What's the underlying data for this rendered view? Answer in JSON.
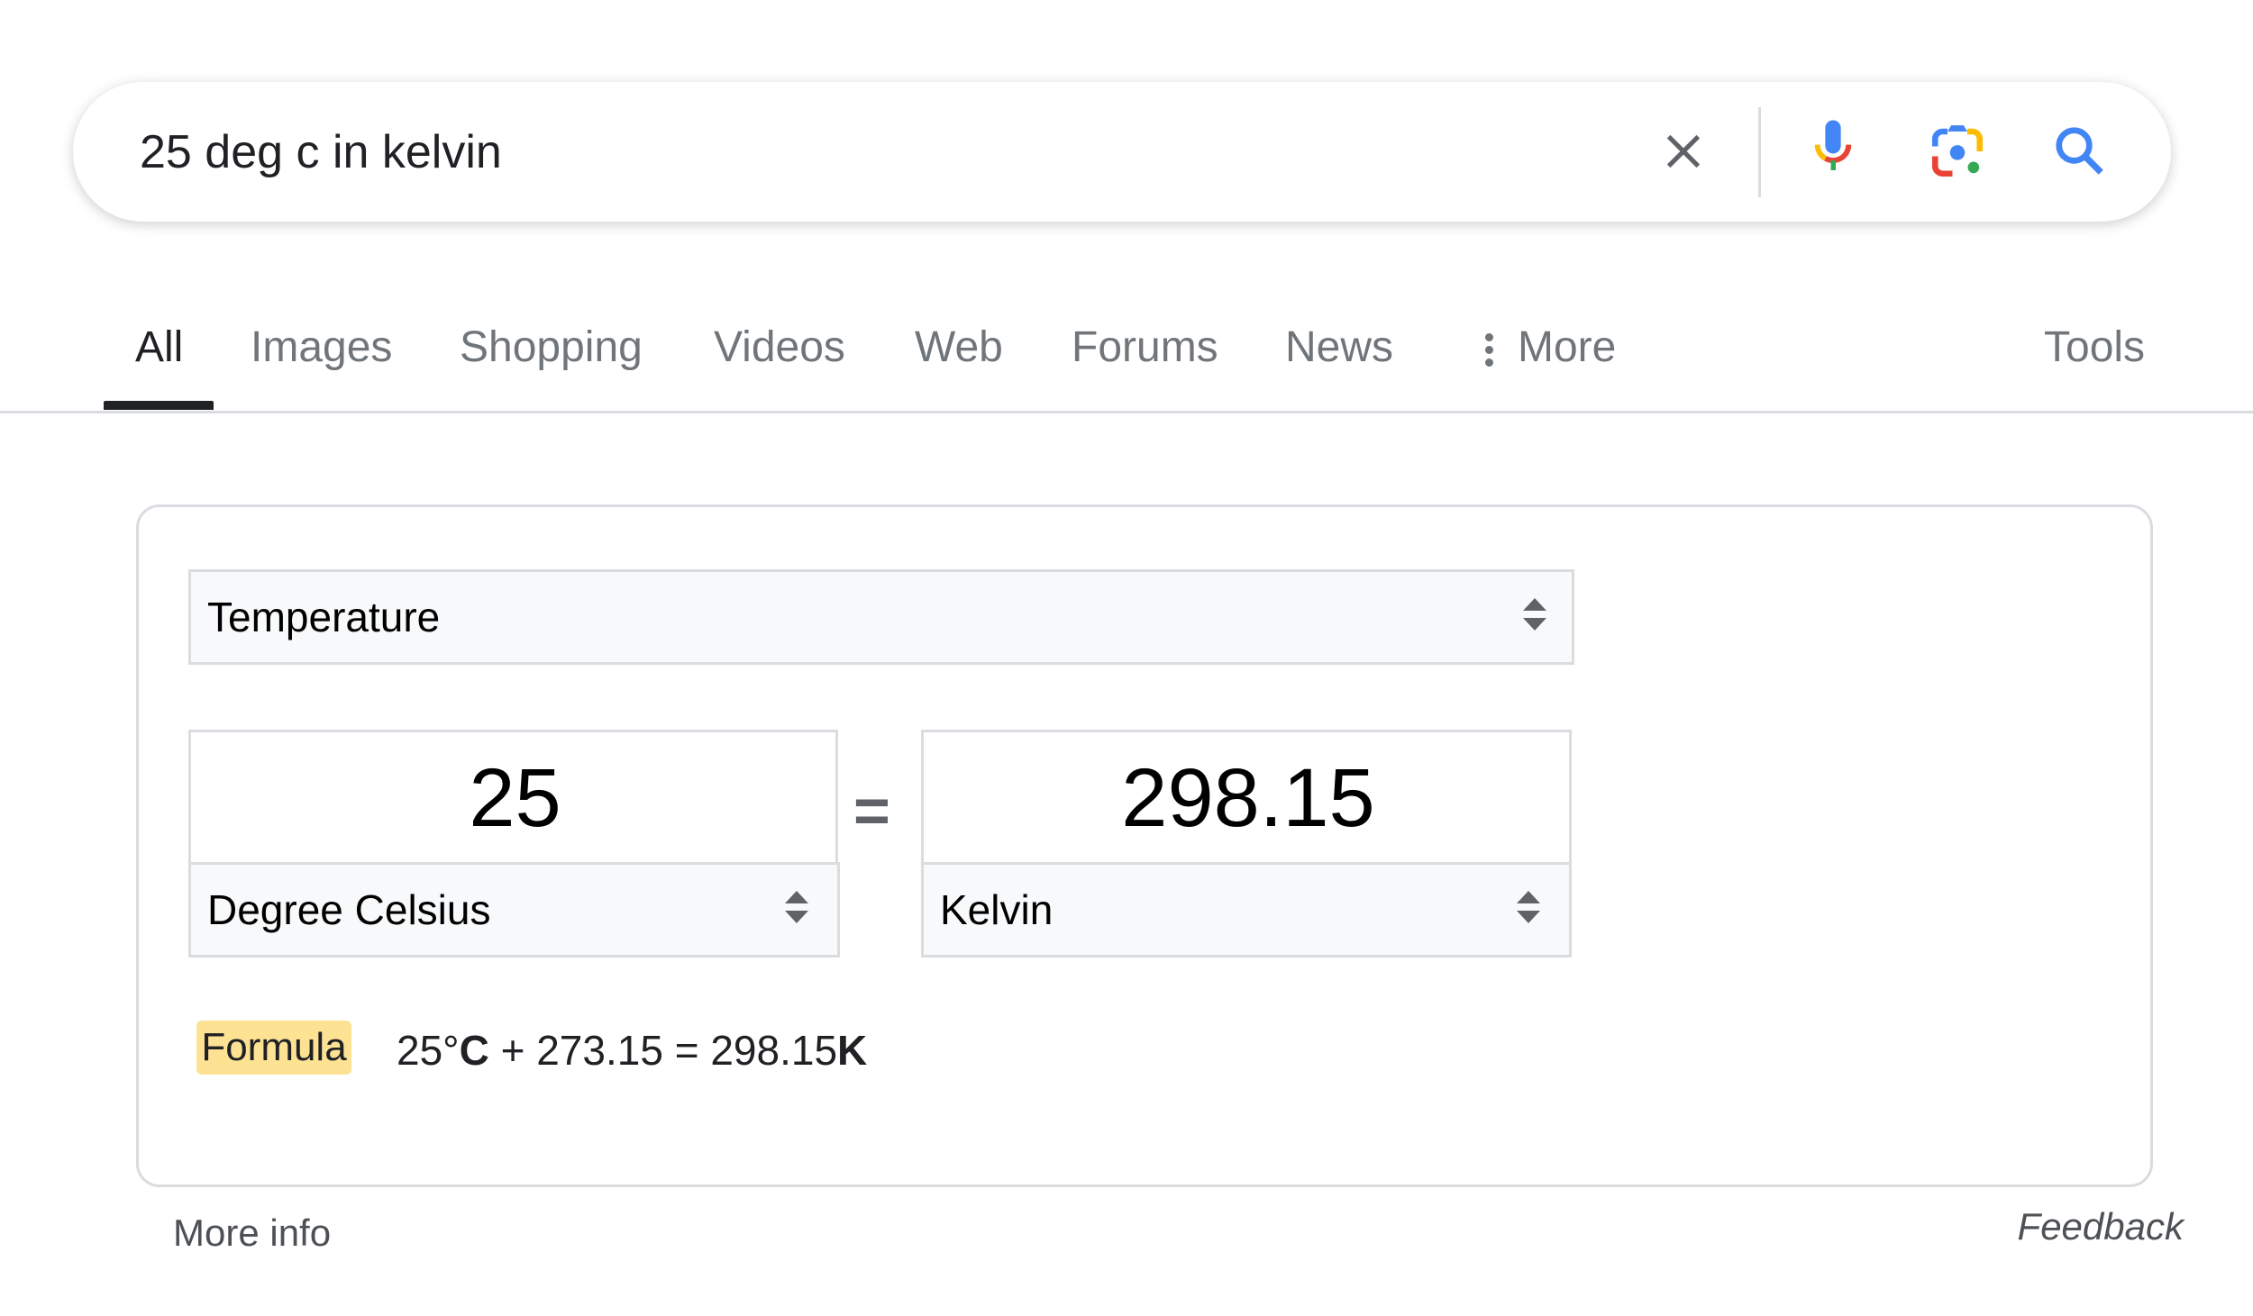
{
  "search": {
    "query": "25 deg c in kelvin",
    "icons": [
      "clear-icon",
      "microphone-icon",
      "google-lens-icon",
      "search-icon"
    ]
  },
  "tabs": [
    {
      "label": "All",
      "active": true
    },
    {
      "label": "Images"
    },
    {
      "label": "Shopping"
    },
    {
      "label": "Videos"
    },
    {
      "label": "Web"
    },
    {
      "label": "Forums"
    },
    {
      "label": "News"
    },
    {
      "label": "More"
    }
  ],
  "tools_label": "Tools",
  "converter": {
    "category": "Temperature",
    "from": {
      "value": "25",
      "unit": "Degree Celsius"
    },
    "equals": "=",
    "to": {
      "value": "298.15",
      "unit": "Kelvin"
    },
    "formula_label": "Formula",
    "formula": {
      "a": "25°",
      "a_unit": "C",
      "mid": " + 273.15 = 298.15",
      "b_unit": "K"
    }
  },
  "footer": {
    "more_info": "More info",
    "feedback": "Feedback"
  },
  "colors": {
    "google_blue": "#4285f4",
    "google_red": "#ea4335",
    "google_yellow": "#fbbc04",
    "google_green": "#34a853",
    "formula_badge": "#fde293"
  }
}
